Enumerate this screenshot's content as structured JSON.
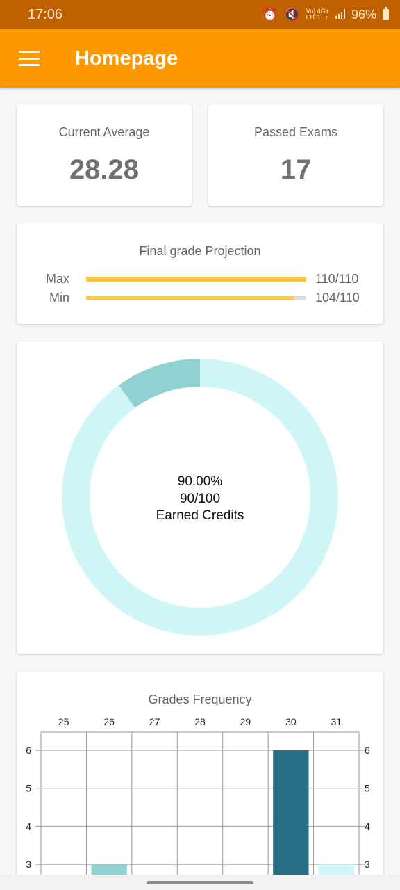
{
  "status_bar": {
    "time": "17:06",
    "network_top": "Vo) 4G+",
    "network_bottom": "LTE1 ↓↑",
    "battery": "96%",
    "icons": [
      "alarm-icon",
      "mute-icon",
      "signal-icon",
      "battery-icon"
    ]
  },
  "app_bar": {
    "title": "Homepage",
    "menu_icon": "hamburger-menu-icon",
    "color": "#fe9800"
  },
  "current_average": {
    "label": "Current Average",
    "value": "28.28"
  },
  "passed_exams": {
    "label": "Passed Exams",
    "value": "17"
  },
  "projection": {
    "title": "Final grade Projection",
    "bar_color": "#f8c84a",
    "rows": [
      {
        "label": "Max",
        "value_text": "110/110",
        "fraction": 1.0
      },
      {
        "label": "Min",
        "value_text": "104/110",
        "fraction": 0.9455
      }
    ]
  },
  "credits": {
    "percent_text": "90.00%",
    "fraction_text": "90/100",
    "caption": "Earned Credits",
    "earned_fraction": 0.9,
    "colors": {
      "main": "#cff6f6",
      "highlight": "#90d2d2"
    }
  },
  "histogram": {
    "title": "Grades Frequency"
  },
  "chart_data": {
    "type": "bar",
    "categories": [
      "25",
      "26",
      "27",
      "28",
      "29",
      "30",
      "31"
    ],
    "values": [
      0,
      3,
      0,
      0,
      0,
      6,
      3
    ],
    "ylim": [
      3,
      6
    ],
    "y_ticks": [
      3,
      4,
      5,
      6
    ],
    "colors": [
      "#cff6f6",
      "#90d2d2",
      "#cff6f6",
      "#cff6f6",
      "#cff6f6",
      "#286e84",
      "#cff6f6"
    ],
    "grid": true
  }
}
